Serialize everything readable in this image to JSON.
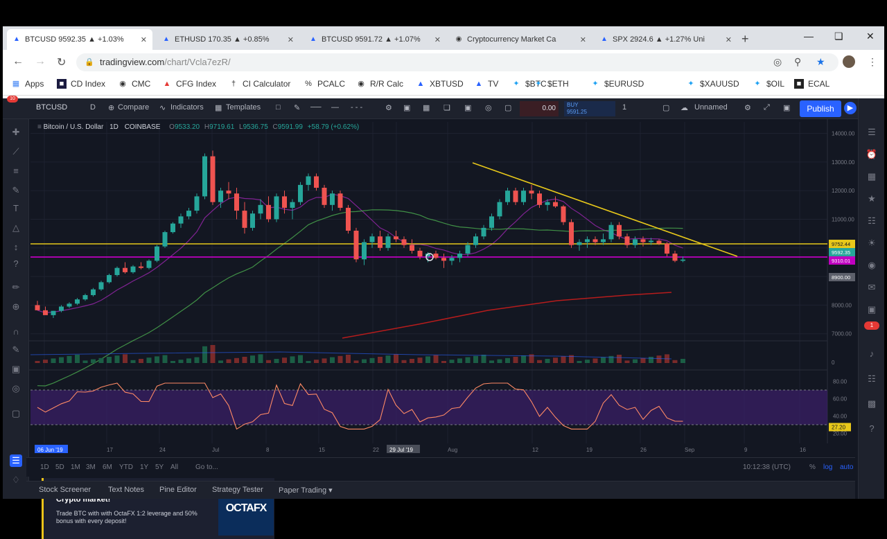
{
  "browser": {
    "tabs": [
      {
        "label": "BTCUSD 9592.35 ▲ +1.03%",
        "active": true
      },
      {
        "label": "ETHUSD 170.35 ▲ +0.85%",
        "active": false
      },
      {
        "label": "BTCUSD 9591.72 ▲ +1.07%",
        "active": false
      },
      {
        "label": "Cryptocurrency Market Ca",
        "active": false
      },
      {
        "label": "SPX 2924.6 ▲ +1.27% Uni",
        "active": false
      }
    ],
    "new_tab": "+",
    "url_host": "tradingview.com",
    "url_path": "/chart/Vcla7ezR/",
    "bookmarks": [
      "Apps",
      "CD Index",
      "CMC",
      "CFG Index",
      "CI Calculator",
      "PCALC",
      "R/R Calc",
      "XBTUSD",
      "TV",
      "$BTC",
      "$ETH",
      "$EURUSD",
      "$XAUUSD",
      "$OIL",
      "ECAL"
    ]
  },
  "toolbar": {
    "symbol": "BTCUSD",
    "interval": "D",
    "compare": "Compare",
    "indicators": "Indicators",
    "templates": "Templates",
    "sell_price": "0.00",
    "buy_label": "BUY",
    "buy_price": "9591.25",
    "qty": "1",
    "layout_name": "Unnamed",
    "publish": "Publish"
  },
  "legend": {
    "title": "Bitcoin / U.S. Dollar",
    "interval": "1D",
    "exchange": "COINBASE",
    "o": "9533.20",
    "h": "9719.61",
    "l": "9536.75",
    "c": "9591.99",
    "change": "+58.79 (+0.62%)"
  },
  "chart_data": {
    "type": "candlestick",
    "symbol": "Bitcoin / U.S. Dollar",
    "interval": "1D",
    "y_ticks": [
      14000,
      13000,
      12000,
      11000,
      10000,
      9000,
      8000,
      7000
    ],
    "price_labels": [
      {
        "value": "9752.44",
        "color": "#e8c81a"
      },
      {
        "value": "9592.35",
        "color": "#26a69a"
      },
      {
        "value": "9310.01",
        "color": "#c000c0"
      },
      {
        "value": "8900.00",
        "color": "#5d606b"
      }
    ],
    "x_ticks": [
      "06 Jun '19",
      "17",
      "24",
      "Jul",
      "8",
      "15",
      "22",
      "29 Jul '19",
      "Aug",
      "12",
      "19",
      "26",
      "Sep",
      "9",
      "16"
    ],
    "candles": [
      [
        8000,
        8150,
        7900,
        7820
      ],
      [
        7820,
        7950,
        7700,
        7650
      ],
      [
        7650,
        7800,
        7550,
        7800
      ],
      [
        7800,
        8000,
        7750,
        7950
      ],
      [
        7950,
        8100,
        7900,
        8050
      ],
      [
        8050,
        8250,
        8000,
        8200
      ],
      [
        8200,
        8400,
        8150,
        8350
      ],
      [
        8350,
        8600,
        8300,
        8550
      ],
      [
        8550,
        8850,
        8500,
        8800
      ],
      [
        8800,
        9100,
        8750,
        9050
      ],
      [
        9050,
        9350,
        9000,
        9300
      ],
      [
        9300,
        9500,
        9100,
        9150
      ],
      [
        9150,
        9400,
        9100,
        9350
      ],
      [
        9350,
        9500,
        9250,
        9300
      ],
      [
        9300,
        9600,
        9250,
        9550
      ],
      [
        9550,
        10100,
        9500,
        10050
      ],
      [
        10050,
        10600,
        10000,
        10550
      ],
      [
        10550,
        10900,
        10500,
        10850
      ],
      [
        10850,
        11200,
        10700,
        11100
      ],
      [
        11100,
        11400,
        11000,
        11300
      ],
      [
        11300,
        11900,
        11200,
        11800
      ],
      [
        11800,
        13300,
        11700,
        13200
      ],
      [
        13200,
        13400,
        11500,
        11600
      ],
      [
        11600,
        12100,
        11400,
        12000
      ],
      [
        12000,
        12300,
        11700,
        11900
      ],
      [
        11900,
        12100,
        11000,
        11300
      ],
      [
        11300,
        11600,
        10500,
        10700
      ],
      [
        10700,
        11300,
        10600,
        11200
      ],
      [
        11200,
        11700,
        11000,
        11500
      ],
      [
        11500,
        11800,
        10900,
        11000
      ],
      [
        11000,
        11900,
        10900,
        11800
      ],
      [
        11800,
        12000,
        11200,
        11400
      ],
      [
        11400,
        11700,
        11000,
        11600
      ],
      [
        11600,
        12300,
        11500,
        12200
      ],
      [
        12200,
        12600,
        12000,
        12500
      ],
      [
        12500,
        12600,
        12000,
        12100
      ],
      [
        12100,
        12200,
        11400,
        11500
      ],
      [
        11500,
        12000,
        11300,
        11900
      ],
      [
        11900,
        12000,
        11300,
        11400
      ],
      [
        11400,
        11500,
        10500,
        10600
      ],
      [
        10600,
        10700,
        9500,
        9600
      ],
      [
        9600,
        10300,
        9400,
        10200
      ],
      [
        10200,
        10500,
        10000,
        10400
      ],
      [
        10400,
        10600,
        9900,
        10000
      ],
      [
        10000,
        10500,
        9900,
        10400
      ],
      [
        10400,
        10600,
        10200,
        10300
      ],
      [
        10300,
        10400,
        10000,
        10100
      ],
      [
        10100,
        10300,
        9800,
        9900
      ],
      [
        9900,
        10000,
        9600,
        9700
      ],
      [
        9700,
        9850,
        9500,
        9800
      ],
      [
        9800,
        9900,
        9600,
        9650
      ],
      [
        9650,
        9800,
        9300,
        9550
      ],
      [
        9550,
        9750,
        9400,
        9650
      ],
      [
        9650,
        9900,
        9500,
        9800
      ],
      [
        9800,
        10200,
        9700,
        10100
      ],
      [
        10100,
        10500,
        10000,
        10400
      ],
      [
        10400,
        10800,
        10300,
        10700
      ],
      [
        10700,
        11200,
        10600,
        11100
      ],
      [
        11100,
        11700,
        11000,
        11600
      ],
      [
        11600,
        12100,
        11500,
        12000
      ],
      [
        12000,
        12100,
        11500,
        11600
      ],
      [
        11600,
        12100,
        11500,
        12000
      ],
      [
        12000,
        12200,
        11700,
        11900
      ],
      [
        11900,
        12000,
        11400,
        11500
      ],
      [
        11500,
        11700,
        11300,
        11600
      ],
      [
        11600,
        11800,
        11400,
        11450
      ],
      [
        11450,
        11500,
        10800,
        10900
      ],
      [
        10900,
        11000,
        10000,
        10100
      ],
      [
        10100,
        10300,
        9900,
        10200
      ],
      [
        10200,
        10400,
        10000,
        10300
      ],
      [
        10300,
        10400,
        10100,
        10200
      ],
      [
        10200,
        10500,
        10100,
        10300
      ],
      [
        10300,
        10900,
        10200,
        10800
      ],
      [
        10800,
        10900,
        10300,
        10400
      ],
      [
        10400,
        10500,
        10000,
        10100
      ],
      [
        10100,
        10400,
        10000,
        10300
      ],
      [
        10300,
        10400,
        10050,
        10200
      ],
      [
        10200,
        10350,
        10100,
        10250
      ],
      [
        10250,
        10300,
        10100,
        10150
      ],
      [
        10150,
        10200,
        9700,
        9800
      ],
      [
        9800,
        9900,
        9500,
        9550
      ],
      [
        9550,
        9700,
        9500,
        9590
      ]
    ],
    "volume_axis_tick": "0",
    "rsi": {
      "ticks": [
        80,
        60,
        40,
        20
      ],
      "last": "27.20",
      "band_range": [
        30,
        70
      ]
    },
    "time_label": "10:12:38 (UTC)"
  },
  "octa_ad": {
    "title": "The most lucrative opportunity in Crypto market!",
    "body": "Trade BTC with with OctaFX 1:2 leverage and 50% bonus with every deposit!",
    "logo": "OCTAFX"
  },
  "range_buttons": [
    "1D",
    "5D",
    "1M",
    "3M",
    "6M",
    "YTD",
    "1Y",
    "5Y",
    "All"
  ],
  "goto": "Go to...",
  "scale_opts": [
    "%",
    "log",
    "auto"
  ],
  "bottom_tabs": [
    "Stock Screener",
    "Text Notes",
    "Pine Editor",
    "Strategy Tester",
    "Paper Trading ▾"
  ],
  "notif_badge": "10",
  "right_badge": "1"
}
